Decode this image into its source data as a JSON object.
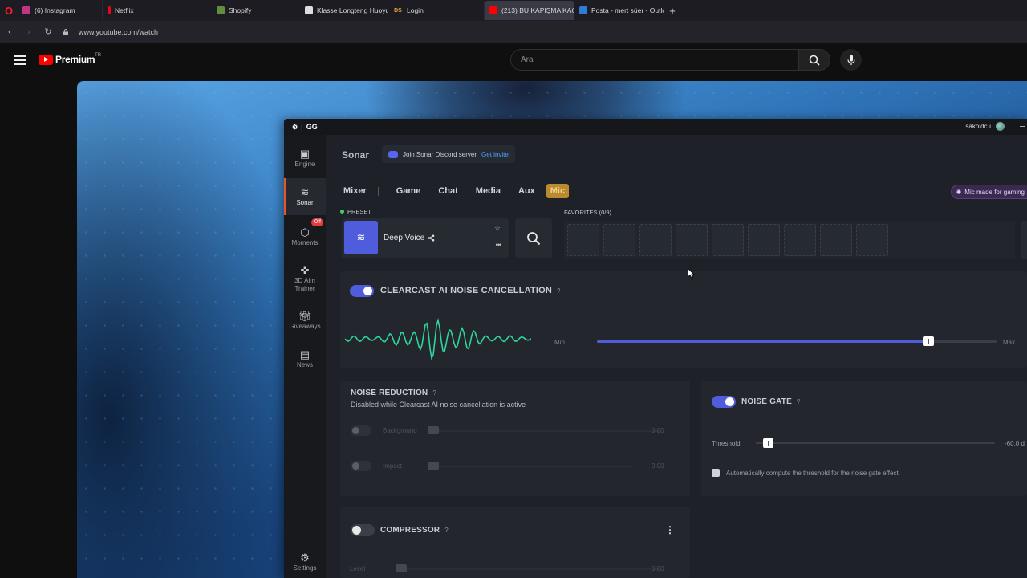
{
  "browser": {
    "tabs": [
      {
        "label": "(6) Instagram",
        "fav_color": "#c13584"
      },
      {
        "label": "Netflix",
        "fav_color": "#e50914"
      },
      {
        "label": "Shopify",
        "fav_color": "#5e8e3e"
      },
      {
        "label": "Klasse Longteng Huoyun",
        "fav_color": "#dddddd"
      },
      {
        "label": "Login",
        "fav_text": "DS",
        "fav_color": "#e5a13a"
      },
      {
        "label": "(213) BU KAPIŞMA KAÇM...",
        "fav_color": "#ff0000"
      },
      {
        "label": "Posta - mert süer - Outloo",
        "fav_color": "#2d7cd6"
      }
    ],
    "url": "www.youtube.com/watch"
  },
  "youtube": {
    "logo_text": "Premium",
    "region": "TR",
    "search_placeholder": "Ara",
    "icons": {
      "menu": "hamburger-icon",
      "search": "search-icon",
      "mic": "microphone-icon"
    }
  },
  "gg": {
    "app_name": "GG",
    "username": "sakoldcu",
    "sidebar": [
      {
        "label": "Engine",
        "icon": "chip-icon"
      },
      {
        "label": "Sonar",
        "icon": "sonar-icon",
        "active": true
      },
      {
        "label": "Moments",
        "icon": "hexagon-icon",
        "badge": "Off"
      },
      {
        "label": "3D Aim Trainer",
        "icon": "aim-icon"
      },
      {
        "label": "Giveaways",
        "icon": "gift-icon"
      },
      {
        "label": "News",
        "icon": "book-icon"
      },
      {
        "label": "Settings",
        "icon": "gear-icon"
      }
    ],
    "sonar_title": "Sonar",
    "discord": {
      "text": "Join Sonar Discord server",
      "link": "Get invite"
    },
    "tabs": [
      "Mixer",
      "Game",
      "Chat",
      "Media",
      "Aux",
      "Mic"
    ],
    "active_tab": "Mic",
    "mic_made_pill": "Mic made for gaming",
    "preset": {
      "label": "PRESET",
      "name": "Deep Voice"
    },
    "favorites_label": "FAVORITES (0/9)",
    "favorites_slots": 9,
    "clearcast": {
      "title": "CLEARCAST AI NOISE CANCELLATION",
      "help": "?",
      "enabled": true,
      "min_label": "Min",
      "max_label": "Max",
      "level": 0.83
    },
    "noise_reduction": {
      "title": "NOISE REDUCTION",
      "help": "?",
      "subtitle": "Disabled while Clearcast AI noise cancellation is active",
      "rows": [
        {
          "label": "Background",
          "value": "0.00"
        },
        {
          "label": "Impact",
          "value": "0.00"
        }
      ]
    },
    "noise_gate": {
      "title": "NOISE GATE",
      "help": "?",
      "enabled": true,
      "threshold_label": "Threshold",
      "threshold_value": "-60.0 d",
      "threshold_level": 0.03,
      "auto_label": "Automatically compute the threshold for the noise gate effect."
    },
    "compressor": {
      "title": "COMPRESSOR",
      "help": "?",
      "enabled": false,
      "level_label": "Level",
      "level_value": "0.00"
    }
  }
}
